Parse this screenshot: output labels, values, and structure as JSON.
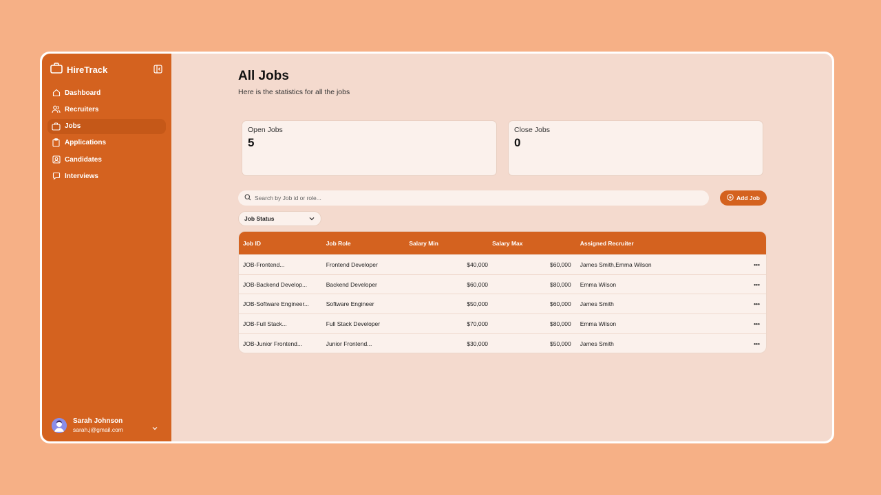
{
  "app": {
    "name": "HireTrack"
  },
  "sidebar": {
    "items": [
      {
        "label": "Dashboard",
        "icon": "home-icon"
      },
      {
        "label": "Recruiters",
        "icon": "users-icon"
      },
      {
        "label": "Jobs",
        "icon": "briefcase-icon",
        "active": true
      },
      {
        "label": "Applications",
        "icon": "clipboard-icon"
      },
      {
        "label": "Candidates",
        "icon": "contact-icon"
      },
      {
        "label": "Interviews",
        "icon": "message-icon"
      }
    ],
    "user": {
      "name": "Sarah Johnson",
      "email": "sarah.j@gmail.com"
    }
  },
  "page": {
    "title": "All Jobs",
    "subtitle": "Here is the statistics for all the jobs"
  },
  "stats": {
    "open": {
      "label": "Open Jobs",
      "value": "5"
    },
    "close": {
      "label": "Close Jobs",
      "value": "0"
    }
  },
  "search": {
    "placeholder": "Search by Job id or role...",
    "value": ""
  },
  "toolbar": {
    "add_label": "Add Job"
  },
  "filter": {
    "status_label": "Job Status"
  },
  "table": {
    "headers": {
      "id": "Job ID",
      "role": "Job Role",
      "min": "Salary Min",
      "max": "Salary Max",
      "recruiter": "Assigned Recruiter"
    },
    "rows": [
      {
        "id": "JOB-Frontend...",
        "role": "Frontend Developer",
        "min": "$40,000",
        "max": "$60,000",
        "recruiter": "James Smith,Emma Wilson",
        "action": "•••"
      },
      {
        "id": "JOB-Backend Develop...",
        "role": "Backend Developer",
        "min": "$60,000",
        "max": "$80,000",
        "recruiter": "Emma Wilson",
        "action": "•••"
      },
      {
        "id": "JOB-Software Engineer...",
        "role": "Software Engineer",
        "min": "$50,000",
        "max": "$60,000",
        "recruiter": "James Smith",
        "action": "•••"
      },
      {
        "id": "JOB-Full Stack...",
        "role": "Full Stack Developer",
        "min": "$70,000",
        "max": "$80,000",
        "recruiter": "Emma Wilson",
        "action": "•••"
      },
      {
        "id": "JOB-Junior Frontend...",
        "role": "Junior Frontend...",
        "min": "$30,000",
        "max": "$50,000",
        "recruiter": "James Smith",
        "action": "•••"
      }
    ]
  },
  "colors": {
    "accent": "#d4621f",
    "background": "#f6b086",
    "panel": "#f4dace",
    "card": "#fbf1ec"
  }
}
